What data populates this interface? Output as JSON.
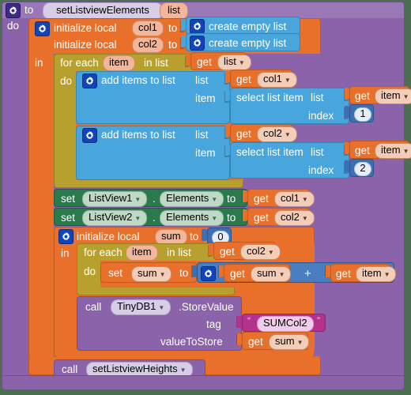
{
  "editor": {
    "background_color": "#4a7050",
    "name": "blocks-canvas"
  },
  "procedure": {
    "keyword_to": "to",
    "name": "setListviewElements",
    "param": "list",
    "keyword_do": "do",
    "gear": "gear-icon"
  },
  "init_outer": {
    "label": "initialize local",
    "var1": "col1",
    "var2": "col2",
    "to1": "to",
    "to2": "to",
    "keyword_in": "in",
    "value1": "create empty list",
    "value2": "create empty list"
  },
  "foreach1": {
    "label_for_each": "for each",
    "var": "item",
    "label_in_list": "in list",
    "keyword_do": "do",
    "list_get_label": "get",
    "list_get_var": "list"
  },
  "add1": {
    "label": "add items to list",
    "socket_list_label": "list",
    "socket_item_label": "item",
    "list_get_label": "get",
    "list_get_var": "col1",
    "select_label": "select list item",
    "select_list_label": "list",
    "select_index_label": "index",
    "select_list_get_label": "get",
    "select_list_get_var": "item",
    "index_value": "1"
  },
  "add2": {
    "label": "add items to list",
    "socket_list_label": "list",
    "socket_item_label": "item",
    "list_get_label": "get",
    "list_get_var": "col2",
    "select_label": "select list item",
    "select_list_label": "list",
    "select_index_label": "index",
    "select_list_get_label": "get",
    "select_list_get_var": "item",
    "index_value": "2"
  },
  "set_rows": [
    {
      "set": "set",
      "component": "ListView1",
      "dot": ".",
      "property": "Elements",
      "to": "to",
      "get": "get",
      "var": "col1"
    },
    {
      "set": "set",
      "component": "ListView2",
      "dot": ".",
      "property": "Elements",
      "to": "to",
      "get": "get",
      "var": "col2"
    }
  ],
  "init_sum": {
    "label": "initialize local",
    "var": "sum",
    "to": "to",
    "value": "0",
    "keyword_in": "in"
  },
  "foreach2": {
    "label_for_each": "for each",
    "var": "item",
    "label_in_list": "in list",
    "keyword_do": "do",
    "list_get_label": "get",
    "list_get_var": "col2"
  },
  "set_sum": {
    "set": "set",
    "var": "sum",
    "to": "to",
    "plus": "+",
    "left_get": "get",
    "left_var": "sum",
    "right_get": "get",
    "right_var": "item"
  },
  "tinydb": {
    "call": "call",
    "component": "TinyDB1",
    "method": ".StoreValue",
    "tag_label": "tag",
    "value_label": "valueToStore",
    "tag_text": "SUMCol2",
    "quote_open": "“",
    "quote_close": "”",
    "value_get": "get",
    "value_var": "sum"
  },
  "call_heights": {
    "call": "call",
    "name": "setListviewHeights"
  }
}
